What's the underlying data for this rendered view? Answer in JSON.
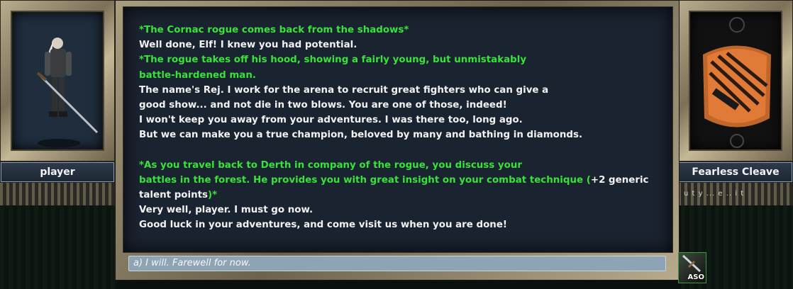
{
  "left_portrait": {
    "name": "player"
  },
  "right_portrait": {
    "name": "Fearless Cleave"
  },
  "side_overlay_text": "u t y ... e .. i t",
  "dialog_lines": [
    {
      "text": "*The Cornac rogue comes back from the shadows*",
      "color": "green"
    },
    {
      "text": "Well done, Elf! I knew you had potential.",
      "color": "white"
    },
    {
      "text": "*The rogue takes off his hood, showing a fairly young, but unmistakably",
      "color": "green"
    },
    {
      "text": "battle-hardened man.",
      "color": "green"
    },
    {
      "text": "The name's Rej. I work for the arena to recruit great fighters who can give a",
      "color": "white"
    },
    {
      "text": "good show... and not die in two blows. You are one of those, indeed!",
      "color": "white"
    },
    {
      "text": "I won't keep you away from your adventures. I was there too, long ago.",
      "color": "white"
    },
    {
      "text": "But we can make you a true champion, beloved by many and bathing in diamonds.",
      "color": "white"
    },
    {
      "text": "",
      "color": "white"
    },
    {
      "text": "*As you travel back to Derth in company of the rogue, you discuss your",
      "color": "green"
    },
    {
      "text": "battles in the forest. He provides you with great insight on your combat technique (",
      "color": "green",
      "tail": "+2 generic"
    },
    {
      "text": "talent points",
      "color": "white",
      "tail_green": ")*"
    },
    {
      "text": "Very well, player. I must go now.",
      "color": "white"
    },
    {
      "text": "Good luck in your adventures, and come visit us when you are done!",
      "color": "white"
    }
  ],
  "answers": [
    {
      "label": "a) I will. Farewell for now."
    }
  ],
  "hotkey": {
    "label": "ASO"
  }
}
